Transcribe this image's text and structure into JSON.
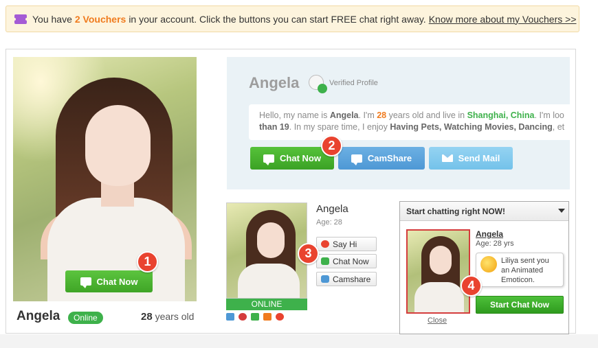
{
  "voucher_bar": {
    "prefix": "You have",
    "count": "2 Vouchers",
    "suffix": "in your account. Click the buttons you can start FREE chat right away.",
    "link": "Know more about my Vouchers >>"
  },
  "main_photo": {
    "chat_button": "Chat Now",
    "badge": "1"
  },
  "profile": {
    "name": "Angela",
    "status": "Online",
    "age_number": "28",
    "age_suffix": "years old"
  },
  "info_panel": {
    "name": "Angela",
    "verified_label": "Verified Profile",
    "bio": {
      "t1": "Hello, my name is",
      "name": "Angela",
      "t2": ". I'm",
      "age": "28",
      "t3": "years old and live in",
      "city": "Shanghai, China",
      "t4": ". I'm loo",
      "t5": "than 19",
      "t6": ". In my spare time, I enjoy",
      "hobbies": "Having Pets, Watching Movies, Dancing",
      "t7": ", et"
    },
    "buttons": {
      "chat": "Chat Now",
      "camshare": "CamShare",
      "mail": "Send Mail"
    },
    "badge": "2"
  },
  "small_profile": {
    "name": "Angela",
    "age": "Age: 28",
    "online": "ONLINE",
    "buttons": {
      "say_hi": "Say Hi",
      "chat": "Chat Now",
      "camshare": "Camshare"
    },
    "badge": "3",
    "icons": [
      "mail-icon",
      "flower-icon",
      "phone-icon",
      "gift-icon",
      "heart-icon"
    ]
  },
  "chat_widget": {
    "title": "Start chatting right NOW!",
    "name": "Angela",
    "age": "Age: 28 yrs",
    "notice": "Liliya sent you an Animated Emoticon.",
    "start_button": "Start Chat Now",
    "close": "Close",
    "badge": "4"
  },
  "colors": {
    "accent_orange": "#f07b1e",
    "green": "#3eb14b",
    "badge_red": "#e9432f",
    "blue": "#4e98d5"
  }
}
